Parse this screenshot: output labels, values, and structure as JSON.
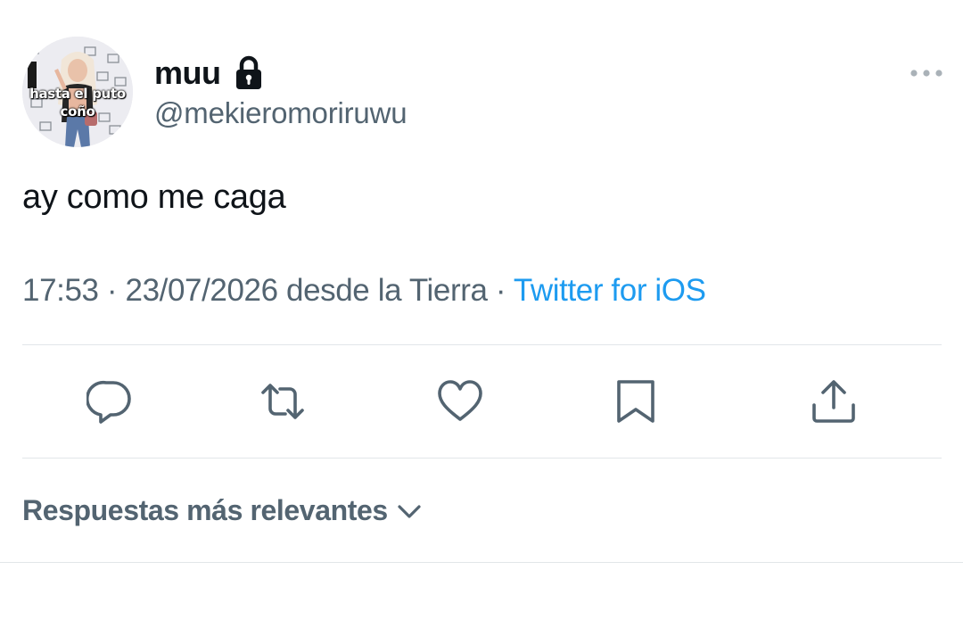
{
  "author": {
    "display_name": "muu",
    "handle": "@mekieromoriruwu",
    "avatar_caption": "hasta el puto coño",
    "protected_icon": "lock-icon"
  },
  "tweet": {
    "text": "ay como me caga",
    "time": "17:53",
    "date": "23/07/2026",
    "location": "desde la Tierra",
    "separator": "·",
    "source": "Twitter for iOS"
  },
  "actions": [
    {
      "name": "reply",
      "icon": "speech-bubble-icon"
    },
    {
      "name": "retweet",
      "icon": "retweet-arrows-icon"
    },
    {
      "name": "like",
      "icon": "heart-icon"
    },
    {
      "name": "bookmark",
      "icon": "bookmark-icon"
    },
    {
      "name": "share",
      "icon": "share-upload-icon"
    }
  ],
  "replies_sort": {
    "label": "Respuestas más relevantes",
    "icon": "chevron-down-icon"
  },
  "colors": {
    "text_primary": "#0f1419",
    "text_secondary": "#536471",
    "link": "#1d9bf0",
    "divider": "#e2e6e9"
  }
}
